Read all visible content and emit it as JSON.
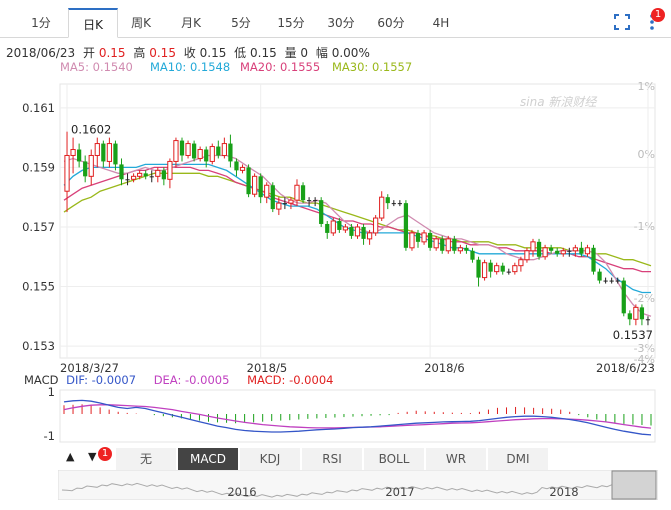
{
  "toolbar": {
    "tabs": [
      {
        "label": "1分"
      },
      {
        "label": "日K"
      },
      {
        "label": "周K"
      },
      {
        "label": "月K"
      },
      {
        "label": "5分"
      },
      {
        "label": "15分"
      },
      {
        "label": "30分"
      },
      {
        "label": "60分"
      },
      {
        "label": "4H"
      }
    ],
    "active_index": 1,
    "badge_count": "1"
  },
  "quote": {
    "date": "2018/06/23",
    "open_label": "开",
    "open": "0.15",
    "high_label": "高",
    "high": "0.15",
    "low_close_label": "收",
    "close": "0.15",
    "low_label": "低",
    "low": "0.15",
    "vol_label": "量",
    "volume": "0",
    "amp_label": "幅",
    "amplitude": "0.00%"
  },
  "ma": {
    "ma5": "MA5: 0.1540",
    "ma10": "MA10: 0.1548",
    "ma20": "MA20: 0.1555",
    "ma30": "MA30: 0.1557",
    "colors": {
      "ma5": "#d08bb0",
      "ma10": "#23a9d8",
      "ma20": "#d8407a",
      "ma30": "#9ab81a"
    }
  },
  "macd": {
    "title": "MACD",
    "dif": "DIF: -0.0007",
    "dea": "DEA: -0.0005",
    "macd": "MACD: -0.0004",
    "axis": [
      "1",
      "-1"
    ]
  },
  "indicators": {
    "up_arrow": "▲",
    "down_arrow": "▼",
    "badge": "1",
    "items": [
      "无",
      "MACD",
      "KDJ",
      "RSI",
      "BOLL",
      "WR",
      "DMI"
    ],
    "active_index": 1
  },
  "overview": {
    "years": [
      "2016",
      "2017",
      "2018"
    ]
  },
  "watermark": "sina 新浪财经",
  "chart_data": {
    "type": "candlestick",
    "y_ticks": [
      "0.161",
      "0.159",
      "0.157",
      "0.155",
      "0.153"
    ],
    "y_pct_ticks": [
      "1%",
      "0%",
      "-1%",
      "-2%",
      "-3%",
      "-4%"
    ],
    "ylim": [
      0.1526,
      0.1618
    ],
    "x_labels": [
      "2018/3/27",
      "2018/5",
      "2018/6",
      "2018/6/23"
    ],
    "max_label": "0.1602",
    "min_label": "0.1537",
    "colors": {
      "up": "#e02020",
      "down": "#18a018",
      "flat": "#222222"
    },
    "candles": [
      [
        0.1582,
        0.1594,
        0.1575,
        0.1602
      ],
      [
        0.1594,
        0.1596,
        0.1588,
        0.16
      ],
      [
        0.1596,
        0.1592,
        0.159,
        0.1598
      ],
      [
        0.1592,
        0.1587,
        0.1585,
        0.1594
      ],
      [
        0.1587,
        0.1594,
        0.1584,
        0.1596
      ],
      [
        0.1594,
        0.1598,
        0.159,
        0.16
      ],
      [
        0.1598,
        0.1592,
        0.159,
        0.1599
      ],
      [
        0.1592,
        0.1598,
        0.159,
        0.16
      ],
      [
        0.1598,
        0.1591,
        0.1589,
        0.1599
      ],
      [
        0.1591,
        0.1586,
        0.1584,
        0.1593
      ],
      [
        0.1586,
        0.1586,
        0.1584,
        0.1588
      ],
      [
        0.1586,
        0.1587,
        0.1585,
        0.1588
      ],
      [
        0.1587,
        0.1588,
        0.1586,
        0.1589
      ],
      [
        0.1588,
        0.1587,
        0.1586,
        0.1589
      ],
      [
        0.1587,
        0.1587,
        0.1585,
        0.1589
      ],
      [
        0.1587,
        0.1589,
        0.1585,
        0.159
      ],
      [
        0.1589,
        0.1586,
        0.1584,
        0.159
      ],
      [
        0.1586,
        0.1592,
        0.1583,
        0.1593
      ],
      [
        0.1592,
        0.1599,
        0.159,
        0.16
      ],
      [
        0.1599,
        0.1594,
        0.1592,
        0.16
      ],
      [
        0.1594,
        0.1598,
        0.1593,
        0.1599
      ],
      [
        0.1598,
        0.1593,
        0.1592,
        0.1599
      ],
      [
        0.1593,
        0.1596,
        0.1592,
        0.1597
      ],
      [
        0.1596,
        0.1592,
        0.159,
        0.1597
      ],
      [
        0.1592,
        0.1597,
        0.1591,
        0.1598
      ],
      [
        0.1597,
        0.1594,
        0.1593,
        0.1599
      ],
      [
        0.1594,
        0.1598,
        0.1593,
        0.16
      ],
      [
        0.1598,
        0.1592,
        0.159,
        0.1601
      ],
      [
        0.1592,
        0.1589,
        0.1587,
        0.1593
      ],
      [
        0.1589,
        0.159,
        0.1588,
        0.1591
      ],
      [
        0.159,
        0.1581,
        0.158,
        0.1591
      ],
      [
        0.1581,
        0.1587,
        0.158,
        0.1588
      ],
      [
        0.1587,
        0.158,
        0.1578,
        0.1588
      ],
      [
        0.158,
        0.1584,
        0.1578,
        0.1585
      ],
      [
        0.1584,
        0.1576,
        0.1575,
        0.1585
      ],
      [
        0.1576,
        0.1578,
        0.1574,
        0.158
      ],
      [
        0.1578,
        0.1578,
        0.1576,
        0.158
      ],
      [
        0.1578,
        0.1579,
        0.1576,
        0.158
      ],
      [
        0.1579,
        0.1584,
        0.1577,
        0.1586
      ],
      [
        0.1584,
        0.1579,
        0.1578,
        0.1585
      ],
      [
        0.1579,
        0.1579,
        0.1577,
        0.158
      ],
      [
        0.1579,
        0.1579,
        0.1577,
        0.158
      ],
      [
        0.1579,
        0.1571,
        0.157,
        0.158
      ],
      [
        0.1571,
        0.1568,
        0.1566,
        0.1572
      ],
      [
        0.1568,
        0.1572,
        0.1567,
        0.1573
      ],
      [
        0.1572,
        0.1569,
        0.1568,
        0.1573
      ],
      [
        0.1569,
        0.157,
        0.1568,
        0.1571
      ],
      [
        0.157,
        0.1567,
        0.1566,
        0.1571
      ],
      [
        0.1567,
        0.157,
        0.1566,
        0.1571
      ],
      [
        0.157,
        0.1566,
        0.1564,
        0.1571
      ],
      [
        0.1566,
        0.1568,
        0.1564,
        0.1569
      ],
      [
        0.1568,
        0.1573,
        0.1567,
        0.1574
      ],
      [
        0.1573,
        0.158,
        0.1572,
        0.1582
      ],
      [
        0.158,
        0.1578,
        0.1576,
        0.1581
      ],
      [
        0.1578,
        0.1578,
        0.1577,
        0.1579
      ],
      [
        0.1578,
        0.1578,
        0.1577,
        0.1579
      ],
      [
        0.1578,
        0.1563,
        0.1562,
        0.1579
      ],
      [
        0.1563,
        0.1568,
        0.1562,
        0.1569
      ],
      [
        0.1568,
        0.1565,
        0.1563,
        0.1569
      ],
      [
        0.1565,
        0.1568,
        0.1564,
        0.1569
      ],
      [
        0.1568,
        0.1563,
        0.1562,
        0.1569
      ],
      [
        0.1563,
        0.1566,
        0.1562,
        0.1567
      ],
      [
        0.1566,
        0.1562,
        0.1561,
        0.1567
      ],
      [
        0.1562,
        0.1566,
        0.1561,
        0.1567
      ],
      [
        0.1566,
        0.1562,
        0.1561,
        0.1567
      ],
      [
        0.1562,
        0.1563,
        0.1561,
        0.1564
      ],
      [
        0.1563,
        0.1562,
        0.1561,
        0.1564
      ],
      [
        0.1562,
        0.1559,
        0.1558,
        0.1563
      ],
      [
        0.1559,
        0.1553,
        0.155,
        0.156
      ],
      [
        0.1553,
        0.1558,
        0.1552,
        0.1559
      ],
      [
        0.1558,
        0.1555,
        0.1553,
        0.1559
      ],
      [
        0.1555,
        0.1557,
        0.1554,
        0.1558
      ],
      [
        0.1557,
        0.1555,
        0.1554,
        0.1558
      ],
      [
        0.1555,
        0.1555,
        0.1554,
        0.1556
      ],
      [
        0.1555,
        0.1557,
        0.1554,
        0.1558
      ],
      [
        0.1557,
        0.1559,
        0.1555,
        0.156
      ],
      [
        0.1559,
        0.1562,
        0.1558,
        0.1563
      ],
      [
        0.1562,
        0.1565,
        0.156,
        0.1566
      ],
      [
        0.1565,
        0.156,
        0.1559,
        0.1566
      ],
      [
        0.156,
        0.1563,
        0.1559,
        0.1564
      ],
      [
        0.1563,
        0.1562,
        0.1561,
        0.1564
      ],
      [
        0.1562,
        0.1561,
        0.156,
        0.1563
      ],
      [
        0.1561,
        0.1562,
        0.156,
        0.1563
      ],
      [
        0.1562,
        0.1562,
        0.156,
        0.1563
      ],
      [
        0.1562,
        0.1563,
        0.156,
        0.1564
      ],
      [
        0.1563,
        0.1561,
        0.156,
        0.1565
      ],
      [
        0.1561,
        0.1563,
        0.156,
        0.1564
      ],
      [
        0.1563,
        0.1555,
        0.1554,
        0.1564
      ],
      [
        0.1555,
        0.1552,
        0.1551,
        0.1556
      ],
      [
        0.1552,
        0.1552,
        0.1551,
        0.1553
      ],
      [
        0.1552,
        0.1552,
        0.1551,
        0.1553
      ],
      [
        0.1552,
        0.1552,
        0.1551,
        0.1553
      ],
      [
        0.1552,
        0.1541,
        0.154,
        0.1553
      ],
      [
        0.1541,
        0.1539,
        0.1537,
        0.1542
      ],
      [
        0.1539,
        0.1543,
        0.1537,
        0.1544
      ],
      [
        0.1543,
        0.1539,
        0.1537,
        0.1544
      ],
      [
        0.1539,
        0.1539,
        0.1537,
        0.154
      ]
    ],
    "ma5": [
      0.1592,
      0.1593,
      0.1592,
      0.1591,
      0.159,
      0.1589,
      0.1588,
      0.1588,
      0.1589,
      0.159,
      0.1589,
      0.1589,
      0.159,
      0.1591,
      0.1592,
      0.1593,
      0.1594,
      0.1594,
      0.1594,
      0.1593,
      0.1591,
      0.1589,
      0.1587,
      0.1584,
      0.1581,
      0.1579,
      0.1578,
      0.1578,
      0.1579,
      0.1578,
      0.1575,
      0.1572,
      0.157,
      0.1569,
      0.1568,
      0.1569,
      0.1571,
      0.1573,
      0.1574,
      0.1572,
      0.157,
      0.1568,
      0.1567,
      0.1566,
      0.1566,
      0.1565,
      0.1564,
      0.1564,
      0.1563,
      0.1561,
      0.156,
      0.1559,
      0.1559,
      0.156,
      0.1561,
      0.1562,
      0.1562,
      0.1562,
      0.1562,
      0.1561,
      0.1558,
      0.1553,
      0.1548,
      0.1544,
      0.1541,
      0.154
    ],
    "ma10": [
      0.1584,
      0.1587,
      0.1589,
      0.159,
      0.159,
      0.159,
      0.159,
      0.159,
      0.159,
      0.1591,
      0.1591,
      0.1591,
      0.1591,
      0.1591,
      0.1591,
      0.1591,
      0.1591,
      0.159,
      0.1589,
      0.1587,
      0.1585,
      0.1583,
      0.1581,
      0.1579,
      0.1578,
      0.1577,
      0.1577,
      0.1577,
      0.1576,
      0.1574,
      0.1572,
      0.157,
      0.1569,
      0.1568,
      0.1568,
      0.1568,
      0.1568,
      0.1568,
      0.1568,
      0.1567,
      0.1566,
      0.1565,
      0.1564,
      0.1563,
      0.1563,
      0.1562,
      0.1561,
      0.1561,
      0.1561,
      0.1561,
      0.1561,
      0.1561,
      0.1561,
      0.1561,
      0.1561,
      0.1561,
      0.1561,
      0.1561,
      0.156,
      0.1558,
      0.1556,
      0.1553,
      0.1551,
      0.1549,
      0.1548,
      0.1548
    ],
    "ma20": [
      0.1579,
      0.1581,
      0.1583,
      0.1584,
      0.1585,
      0.1586,
      0.1587,
      0.1588,
      0.1589,
      0.1589,
      0.159,
      0.159,
      0.159,
      0.159,
      0.159,
      0.1589,
      0.1589,
      0.1588,
      0.1587,
      0.1585,
      0.1584,
      0.1583,
      0.1582,
      0.158,
      0.1579,
      0.1578,
      0.1577,
      0.1576,
      0.1575,
      0.1574,
      0.1573,
      0.1572,
      0.1572,
      0.1571,
      0.1571,
      0.157,
      0.157,
      0.1569,
      0.1568,
      0.1568,
      0.1567,
      0.1566,
      0.1566,
      0.1565,
      0.1565,
      0.1564,
      0.1564,
      0.1564,
      0.1563,
      0.1563,
      0.1562,
      0.1562,
      0.1562,
      0.1562,
      0.1561,
      0.1561,
      0.1561,
      0.156,
      0.156,
      0.1559,
      0.1558,
      0.1557,
      0.1556,
      0.1556,
      0.1555,
      0.1555
    ],
    "ma30": [
      0.1575,
      0.1577,
      0.1579,
      0.158,
      0.1582,
      0.1583,
      0.1584,
      0.1585,
      0.1586,
      0.1587,
      0.1588,
      0.1588,
      0.1588,
      0.1588,
      0.1588,
      0.1588,
      0.1587,
      0.1587,
      0.1586,
      0.1585,
      0.1584,
      0.1583,
      0.1582,
      0.1581,
      0.158,
      0.158,
      0.1579,
      0.1578,
      0.1578,
      0.1577,
      0.1576,
      0.1575,
      0.1574,
      0.1573,
      0.1572,
      0.1571,
      0.157,
      0.1569,
      0.1569,
      0.1568,
      0.1567,
      0.1567,
      0.1566,
      0.1566,
      0.1565,
      0.1565,
      0.1565,
      0.1565,
      0.1564,
      0.1564,
      0.1564,
      0.1563,
      0.1563,
      0.1563,
      0.1563,
      0.1563,
      0.1562,
      0.1562,
      0.1562,
      0.1561,
      0.1561,
      0.156,
      0.1559,
      0.1559,
      0.1558,
      0.1557
    ],
    "macd_hist": [
      0.4,
      0.42,
      0.44,
      0.4,
      0.3,
      0.2,
      0.1,
      0.05,
      0.02,
      0.0,
      -0.05,
      -0.1,
      -0.15,
      -0.2,
      -0.25,
      -0.3,
      -0.35,
      -0.38,
      -0.4,
      -0.42,
      -0.4,
      -0.38,
      -0.35,
      -0.32,
      -0.3,
      -0.28,
      -0.25,
      -0.22,
      -0.2,
      -0.18,
      -0.16,
      -0.14,
      -0.12,
      -0.1,
      -0.08,
      -0.06,
      -0.05,
      0.05,
      0.1,
      0.15,
      0.12,
      0.1,
      0.08,
      0.06,
      0.05,
      0.04,
      0.1,
      0.2,
      0.28,
      0.3,
      0.32,
      0.3,
      0.28,
      0.26,
      0.24,
      0.2,
      0.1,
      -0.05,
      -0.15,
      -0.25,
      -0.35,
      -0.42,
      -0.45,
      -0.48,
      -0.5,
      -0.52
    ],
    "dif": [
      0.55,
      0.6,
      0.62,
      0.58,
      0.5,
      0.4,
      0.3,
      0.25,
      0.3,
      0.25,
      0.15,
      0.05,
      -0.05,
      -0.15,
      -0.25,
      -0.35,
      -0.45,
      -0.55,
      -0.62,
      -0.7,
      -0.75,
      -0.78,
      -0.8,
      -0.82,
      -0.82,
      -0.8,
      -0.78,
      -0.75,
      -0.72,
      -0.7,
      -0.68,
      -0.65,
      -0.62,
      -0.6,
      -0.58,
      -0.55,
      -0.52,
      -0.48,
      -0.45,
      -0.42,
      -0.4,
      -0.38,
      -0.36,
      -0.35,
      -0.34,
      -0.33,
      -0.3,
      -0.25,
      -0.2,
      -0.15,
      -0.12,
      -0.1,
      -0.1,
      -0.12,
      -0.15,
      -0.2,
      -0.25,
      -0.32,
      -0.4,
      -0.5,
      -0.6,
      -0.7,
      -0.78,
      -0.85,
      -0.92,
      -0.95
    ],
    "dea": [
      0.2,
      0.28,
      0.35,
      0.4,
      0.42,
      0.42,
      0.4,
      0.38,
      0.36,
      0.34,
      0.3,
      0.25,
      0.2,
      0.12,
      0.05,
      -0.02,
      -0.1,
      -0.18,
      -0.25,
      -0.32,
      -0.38,
      -0.43,
      -0.48,
      -0.52,
      -0.55,
      -0.58,
      -0.6,
      -0.62,
      -0.63,
      -0.63,
      -0.63,
      -0.62,
      -0.61,
      -0.6,
      -0.59,
      -0.58,
      -0.56,
      -0.54,
      -0.52,
      -0.5,
      -0.48,
      -0.46,
      -0.44,
      -0.42,
      -0.41,
      -0.4,
      -0.38,
      -0.35,
      -0.32,
      -0.29,
      -0.26,
      -0.24,
      -0.22,
      -0.21,
      -0.21,
      -0.22,
      -0.23,
      -0.25,
      -0.28,
      -0.32,
      -0.36,
      -0.42,
      -0.48,
      -0.54,
      -0.6,
      -0.64
    ]
  }
}
